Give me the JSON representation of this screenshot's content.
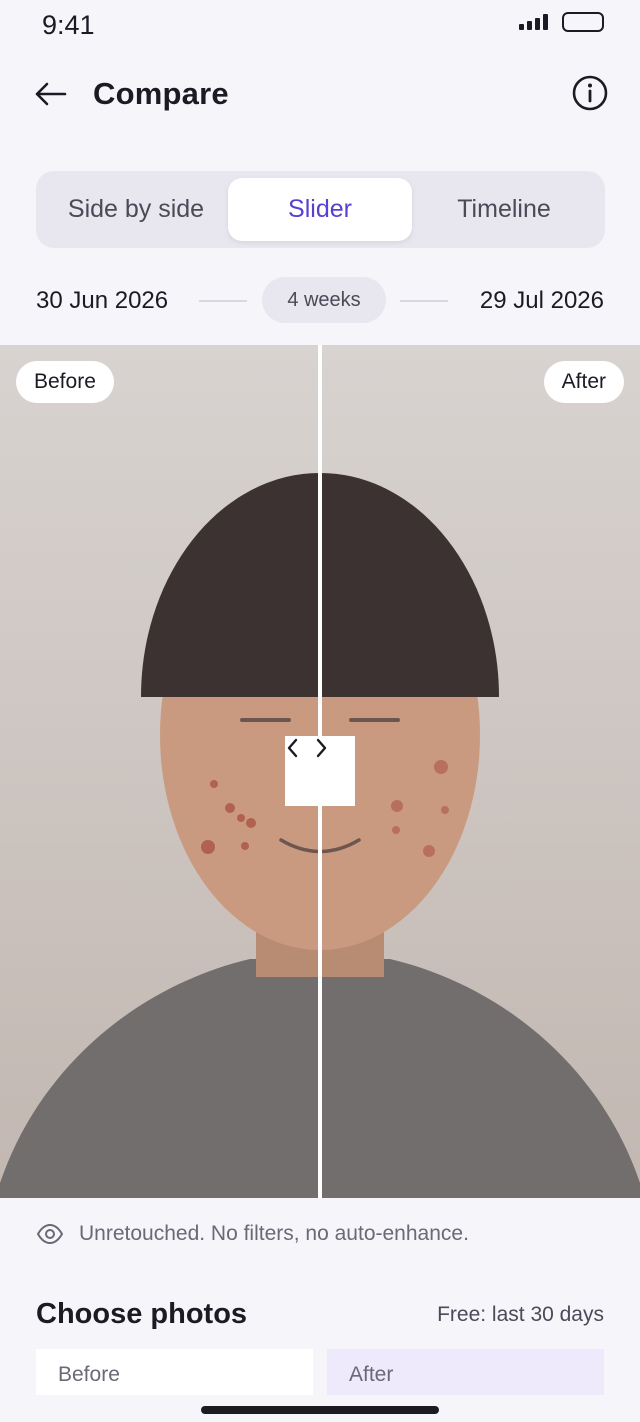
{
  "status": {
    "time": "9:41"
  },
  "header": {
    "title": "Compare",
    "back_icon": "arrow-left-icon",
    "info_icon": "info-icon"
  },
  "view_modes": {
    "selected": "Slider",
    "options": [
      "Side by side",
      "Slider",
      "Timeline"
    ]
  },
  "date_range": {
    "start": "30 Jun 2026",
    "end": "29 Jul 2026",
    "duration": "4 weeks"
  },
  "compare": {
    "before_label": "Before",
    "after_label": "After",
    "slider_position": 0.5,
    "handle_icon": "chevrons-left-right-icon"
  },
  "note": {
    "icon": "eye-icon",
    "text": "Unretouched. No filters, no auto-enhance."
  },
  "choose": {
    "title": "Choose photos",
    "meta": "Free: last 30 days",
    "before_label": "Before",
    "after_label": "After"
  },
  "colors": {
    "accent": "#5a3fd0",
    "background": "#f5f5fa",
    "hair": "#3c3232",
    "skin": "#c99a80",
    "shirt": "#726e6d",
    "blemish": "#b0614f"
  }
}
